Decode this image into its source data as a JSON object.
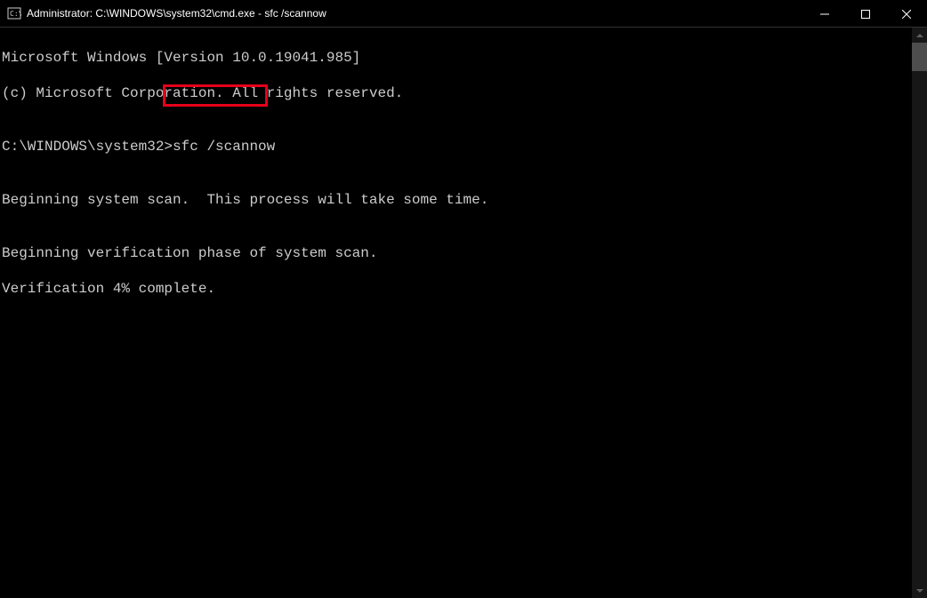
{
  "titlebar": {
    "title": "Administrator: C:\\WINDOWS\\system32\\cmd.exe - sfc  /scannow"
  },
  "terminal": {
    "line1": "Microsoft Windows [Version 10.0.19041.985]",
    "line2": "(c) Microsoft Corporation. All rights reserved.",
    "blank1": "",
    "prompt": "C:\\WINDOWS\\system32>",
    "command": "sfc /scannow",
    "blank2": "",
    "line3": "Beginning system scan.  This process will take some time.",
    "blank3": "",
    "line4": "Beginning verification phase of system scan.",
    "line5": "Verification 4% complete."
  },
  "highlight": {
    "target": "sfc /scannow",
    "color": "#e6001a"
  }
}
